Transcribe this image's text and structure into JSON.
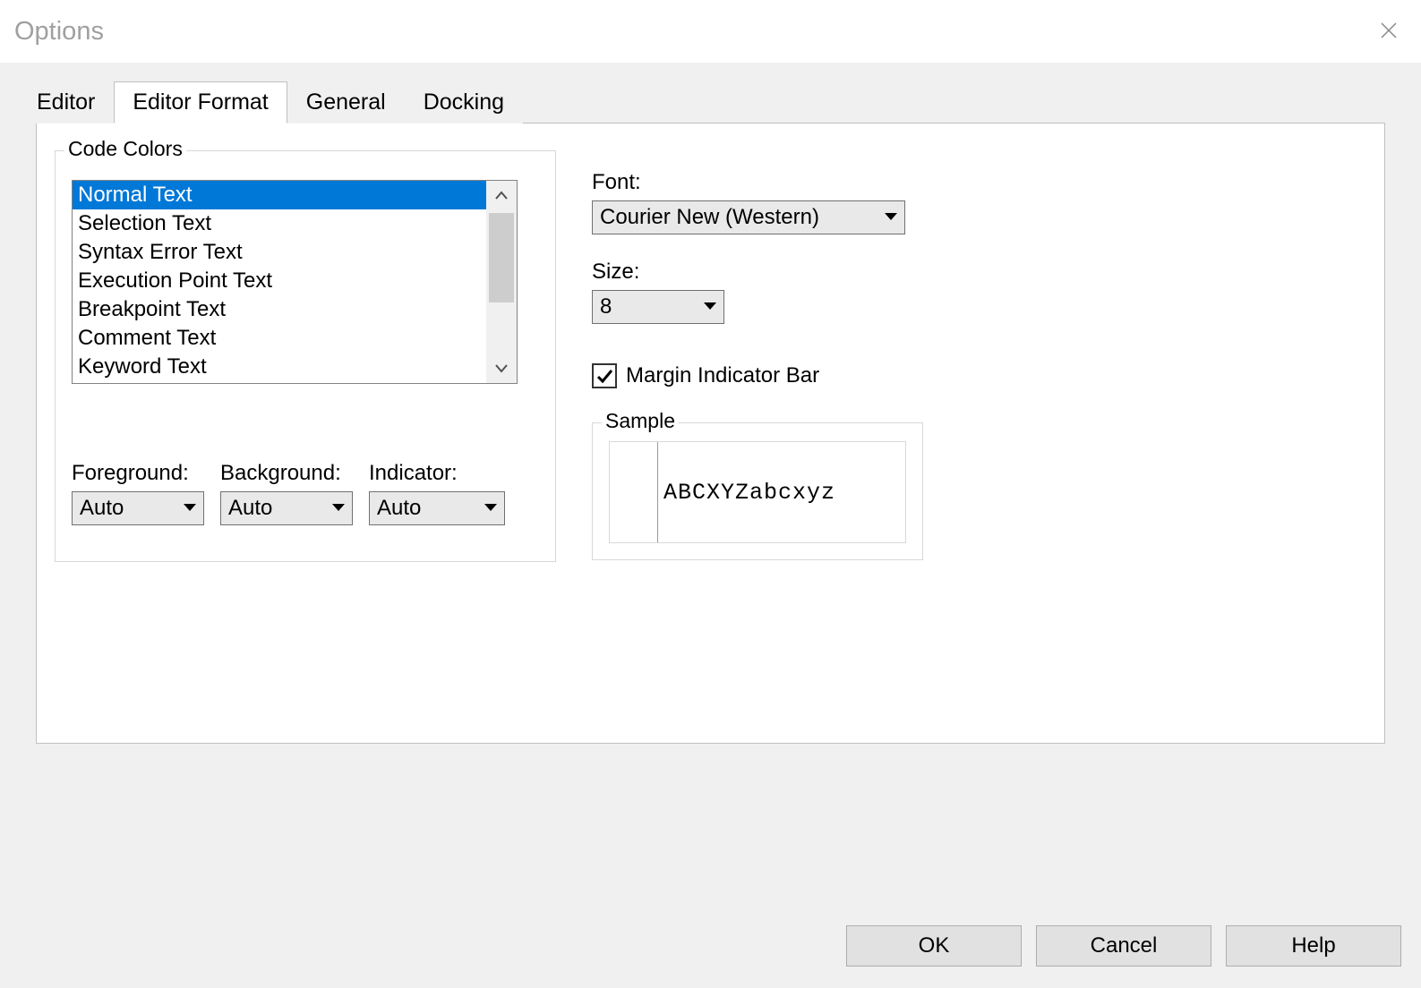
{
  "window": {
    "title": "Options"
  },
  "tabs": {
    "items": [
      "Editor",
      "Editor Format",
      "General",
      "Docking"
    ],
    "active_index": 1
  },
  "code_colors": {
    "legend": "Code Colors",
    "items": [
      "Normal Text",
      "Selection Text",
      "Syntax Error Text",
      "Execution Point Text",
      "Breakpoint Text",
      "Comment Text",
      "Keyword Text"
    ],
    "selected_index": 0
  },
  "colors": {
    "foreground_label": "Foreground:",
    "foreground_value": "Auto",
    "background_label": "Background:",
    "background_value": "Auto",
    "indicator_label": "Indicator:",
    "indicator_value": "Auto"
  },
  "font": {
    "label": "Font:",
    "value": "Courier New (Western)"
  },
  "size": {
    "label": "Size:",
    "value": "8"
  },
  "margin_indicator": {
    "label": "Margin Indicator Bar",
    "checked": true
  },
  "sample": {
    "legend": "Sample",
    "text": "ABCXYZabcxyz"
  },
  "buttons": {
    "ok": "OK",
    "cancel": "Cancel",
    "help": "Help"
  }
}
